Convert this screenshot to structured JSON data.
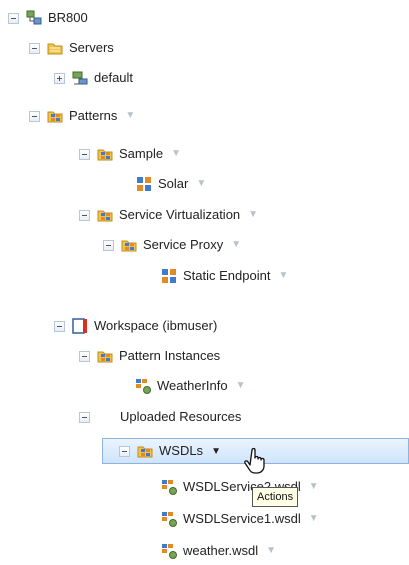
{
  "tree": {
    "root": {
      "label": "BR800"
    },
    "servers": {
      "label": "Servers"
    },
    "default": {
      "label": "default"
    },
    "patterns": {
      "label": "Patterns"
    },
    "sample": {
      "label": "Sample"
    },
    "solar": {
      "label": "Solar"
    },
    "service_virtualization": {
      "label": "Service Virtualization"
    },
    "service_proxy": {
      "label": "Service Proxy"
    },
    "static_endpoint": {
      "label": "Static Endpoint"
    },
    "workspace": {
      "label": "Workspace (ibmuser)"
    },
    "pattern_instances": {
      "label": "Pattern Instances"
    },
    "weatherinfo": {
      "label": "WeatherInfo"
    },
    "uploaded_resources": {
      "label": "Uploaded Resources"
    },
    "wsdls": {
      "label": "WSDLs"
    },
    "wsdl_service2": {
      "label": "WSDLService2.wsdl"
    },
    "wsdl_service1": {
      "label": "WSDLService1.wsdl"
    },
    "weather_wsdl": {
      "label": "weather.wsdl"
    }
  },
  "tooltip": {
    "text": "Actions"
  },
  "colors": {
    "selection_top": "#eaf4ff",
    "selection_bottom": "#cfe4fb",
    "selection_border": "#8fb3df",
    "tooltip_bg": "#ffffe8"
  },
  "icons": {
    "tree_toggle": "minus-box-icon",
    "collapsed_toggle": "plus-box-icon",
    "server_root": "server-root-icon",
    "folder": "folder-stack-icon",
    "pattern": "pattern-grid-icon",
    "workspace": "workspace-icon",
    "wsdl": "wsdl-service-icon",
    "actions": "dropdown-arrow-icon",
    "pointer": "hand-pointer-icon"
  }
}
